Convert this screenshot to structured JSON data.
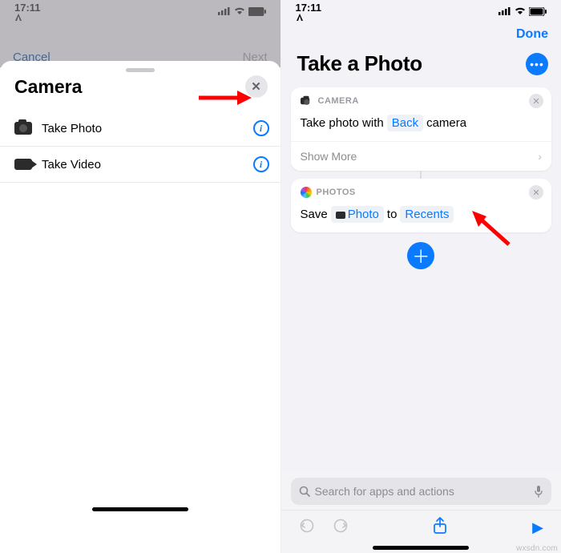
{
  "status_time": "17:11",
  "left": {
    "cancel": "Cancel",
    "next": "Next",
    "sheet_title": "Camera",
    "rows": [
      {
        "label": "Take Photo"
      },
      {
        "label": "Take Video"
      }
    ]
  },
  "right": {
    "done": "Done",
    "title": "Take a Photo",
    "cards": {
      "camera": {
        "name": "CAMERA",
        "prefix": "Take photo with",
        "token": "Back",
        "suffix": "camera",
        "show_more": "Show More"
      },
      "photos": {
        "name": "PHOTOS",
        "prefix": "Save",
        "token1": "Photo",
        "mid": "to",
        "token2": "Recents"
      }
    },
    "search_placeholder": "Search for apps and actions"
  },
  "watermark": "wxsdn.com"
}
